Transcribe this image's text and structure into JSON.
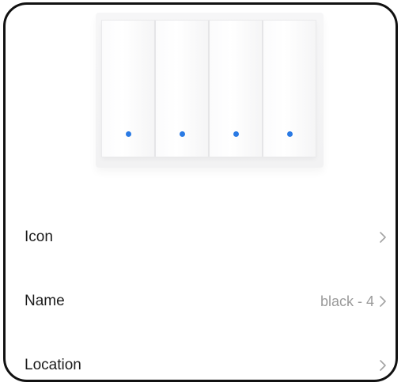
{
  "device": {
    "buttons": 4,
    "led_color": "#2a7ae4"
  },
  "settings": {
    "rows": [
      {
        "label": "Icon",
        "value": ""
      },
      {
        "label": "Name",
        "value": "black - 4"
      },
      {
        "label": "Location",
        "value": ""
      }
    ]
  },
  "icons": {
    "row_arrow": "chevron-right-icon"
  }
}
